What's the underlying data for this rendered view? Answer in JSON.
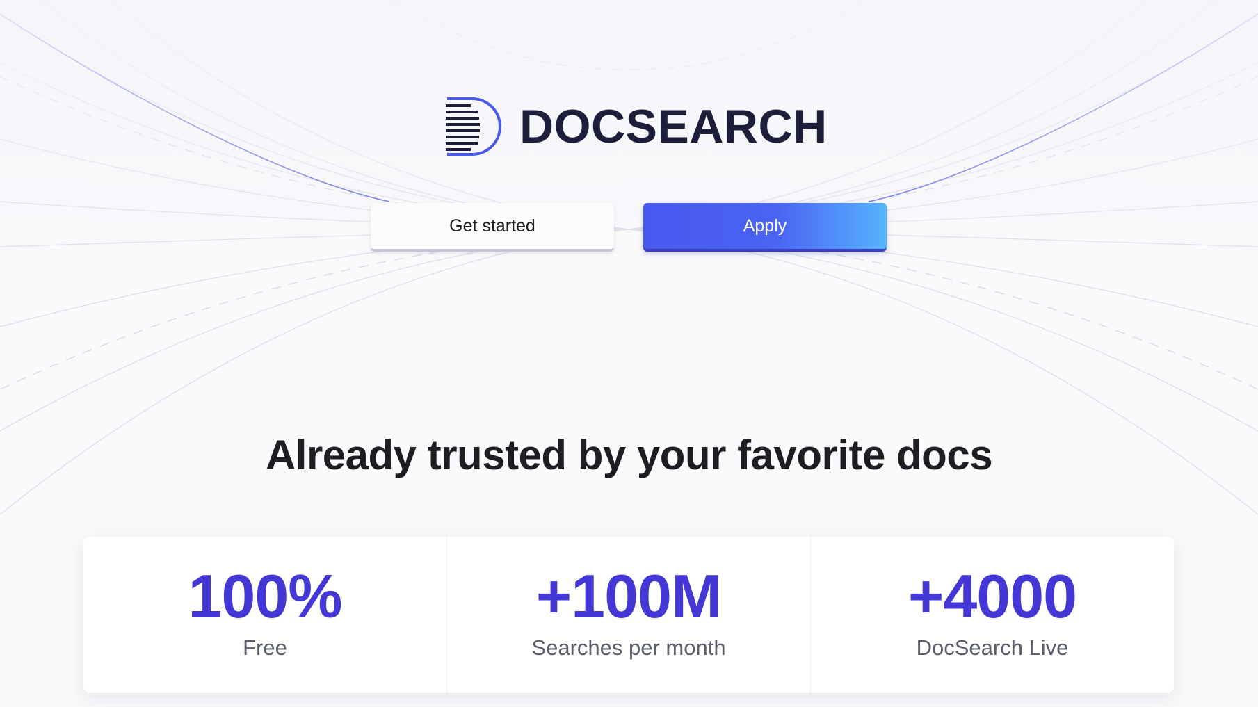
{
  "brand": {
    "name": "DOCSEARCH",
    "logo_icon": "docsearch-d-icon",
    "text_color": "#1c1e3a",
    "accent_color": "#4a5aee"
  },
  "actions": {
    "get_started_label": "Get started",
    "apply_label": "Apply"
  },
  "headline": "Already trusted by your favorite docs",
  "stats": [
    {
      "value": "100%",
      "label": "Free"
    },
    {
      "value": "+100M",
      "label": "Searches per month"
    },
    {
      "value": "+4000",
      "label": "DocSearch Live"
    }
  ],
  "colors": {
    "stat_value": "#4338d6",
    "apply_gradient_start": "#4858ee",
    "apply_gradient_end": "#56b4fb",
    "background": "#fafafc"
  }
}
